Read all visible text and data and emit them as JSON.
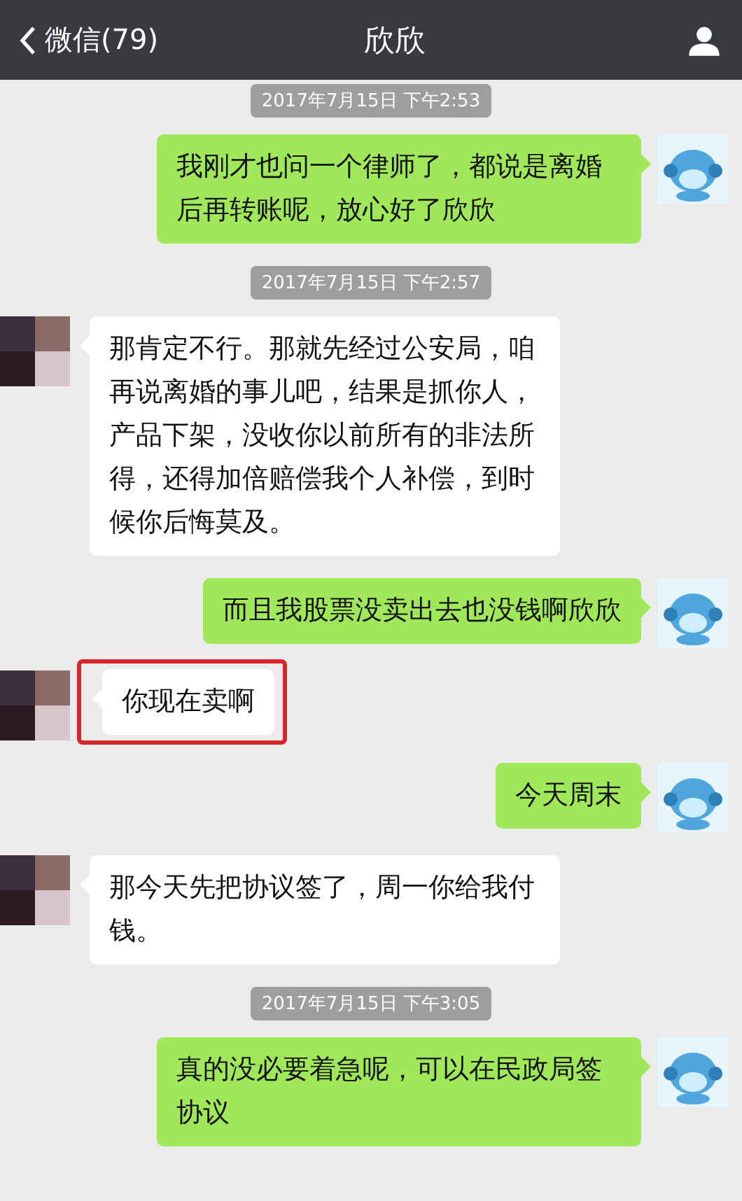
{
  "header": {
    "back_label": "微信(79)",
    "title": "欣欣"
  },
  "messages": [
    {
      "kind": "timestamp",
      "text": "2017年7月15日 下午2:53"
    },
    {
      "kind": "sent",
      "text": "我刚才也问一个律师了，都说是离婚后再转账呢，放心好了欣欣",
      "highlighted": false
    },
    {
      "kind": "timestamp",
      "text": "2017年7月15日 下午2:57"
    },
    {
      "kind": "received",
      "text": "那肯定不行。那就先经过公安局，咱再说离婚的事儿吧，结果是抓你人，产品下架，没收你以前所有的非法所得，还得加倍赔偿我个人补偿，到时候你后悔莫及。",
      "highlighted": false
    },
    {
      "kind": "sent",
      "text": "而且我股票没卖出去也没钱啊欣欣",
      "highlighted": false
    },
    {
      "kind": "received",
      "text": "你现在卖啊",
      "highlighted": true
    },
    {
      "kind": "sent",
      "text": "今天周末",
      "highlighted": false
    },
    {
      "kind": "received",
      "text": "那今天先把协议签了，周一你给我付钱。",
      "highlighted": false
    },
    {
      "kind": "timestamp",
      "text": "2017年7月15日 下午3:05"
    },
    {
      "kind": "sent",
      "text": "真的没必要着急呢，可以在民政局签协议",
      "highlighted": false
    }
  ]
}
